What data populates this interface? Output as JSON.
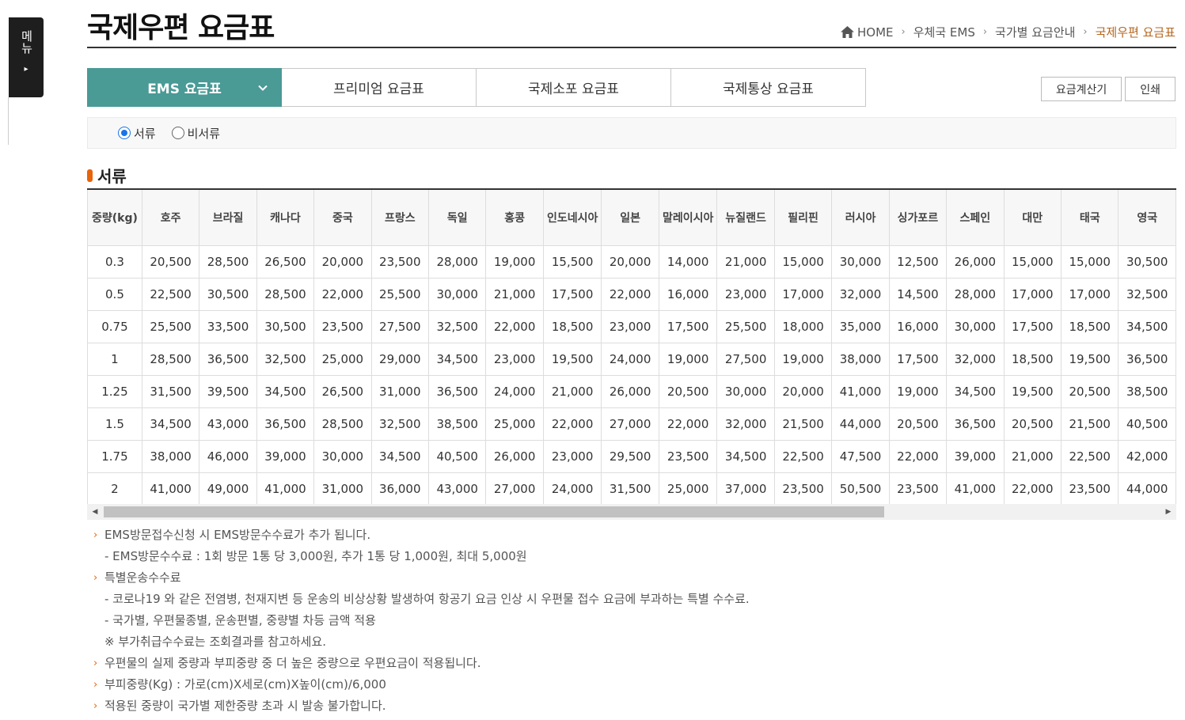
{
  "side_menu": {
    "label": "메뉴",
    "arrow": "▸"
  },
  "page_title": "국제우편 요금표",
  "breadcrumb": [
    "HOME",
    "우체국 EMS",
    "국가별 요금안내",
    "국제우편 요금표"
  ],
  "tabs": [
    "EMS 요금표",
    "프리미엄 요금표",
    "국제소포 요금표",
    "국제통상 요금표"
  ],
  "tools": {
    "calc": "요금계산기",
    "print": "인쇄"
  },
  "radios": {
    "doc": "서류",
    "nondoc": "비서류",
    "selected": "doc"
  },
  "section_title": "서류",
  "table": {
    "weight_header": "중량(kg)",
    "countries": [
      "호주",
      "브라질",
      "캐나다",
      "중국",
      "프랑스",
      "독일",
      "홍콩",
      "인도네시아",
      "일본",
      "말레이시아",
      "뉴질랜드",
      "필리핀",
      "러시아",
      "싱가포르",
      "스페인",
      "대만",
      "태국",
      "영국"
    ],
    "rows": [
      {
        "w": "0.3",
        "v": [
          "20,500",
          "28,500",
          "26,500",
          "20,000",
          "23,500",
          "28,000",
          "19,000",
          "15,500",
          "20,000",
          "14,000",
          "21,000",
          "15,000",
          "30,000",
          "12,500",
          "26,000",
          "15,000",
          "15,000",
          "30,500"
        ]
      },
      {
        "w": "0.5",
        "v": [
          "22,500",
          "30,500",
          "28,500",
          "22,000",
          "25,500",
          "30,000",
          "21,000",
          "17,500",
          "22,000",
          "16,000",
          "23,000",
          "17,000",
          "32,000",
          "14,500",
          "28,000",
          "17,000",
          "17,000",
          "32,500"
        ]
      },
      {
        "w": "0.75",
        "v": [
          "25,500",
          "33,500",
          "30,500",
          "23,500",
          "27,500",
          "32,500",
          "22,000",
          "18,500",
          "23,000",
          "17,500",
          "25,500",
          "18,000",
          "35,000",
          "16,000",
          "30,000",
          "17,500",
          "18,500",
          "34,500"
        ]
      },
      {
        "w": "1",
        "v": [
          "28,500",
          "36,500",
          "32,500",
          "25,000",
          "29,000",
          "34,500",
          "23,000",
          "19,500",
          "24,000",
          "19,000",
          "27,500",
          "19,000",
          "38,000",
          "17,500",
          "32,000",
          "18,500",
          "19,500",
          "36,500"
        ]
      },
      {
        "w": "1.25",
        "v": [
          "31,500",
          "39,500",
          "34,500",
          "26,500",
          "31,000",
          "36,500",
          "24,000",
          "21,000",
          "26,000",
          "20,500",
          "30,000",
          "20,000",
          "41,000",
          "19,000",
          "34,500",
          "19,500",
          "20,500",
          "38,500"
        ]
      },
      {
        "w": "1.5",
        "v": [
          "34,500",
          "43,000",
          "36,500",
          "28,500",
          "32,500",
          "38,500",
          "25,000",
          "22,000",
          "27,000",
          "22,000",
          "32,000",
          "21,500",
          "44,000",
          "20,500",
          "36,500",
          "20,500",
          "21,500",
          "40,500"
        ]
      },
      {
        "w": "1.75",
        "v": [
          "38,000",
          "46,000",
          "39,000",
          "30,000",
          "34,500",
          "40,500",
          "26,000",
          "23,000",
          "29,500",
          "23,500",
          "34,500",
          "22,500",
          "47,500",
          "22,000",
          "39,000",
          "21,000",
          "22,500",
          "42,000"
        ]
      },
      {
        "w": "2",
        "v": [
          "41,000",
          "49,000",
          "41,000",
          "31,000",
          "36,000",
          "43,000",
          "27,000",
          "24,000",
          "31,500",
          "25,000",
          "37,000",
          "23,500",
          "50,500",
          "23,500",
          "41,000",
          "22,000",
          "23,500",
          "44,000"
        ]
      }
    ]
  },
  "scroll": {
    "left": "◀",
    "right": "▶"
  },
  "notes": [
    {
      "type": "main",
      "text": "EMS방문접수신청 시 EMS방문수수료가 추가 됩니다."
    },
    {
      "type": "sub",
      "text": "- EMS방문수수료 : 1회 방문 1통 당 3,000원, 추가 1통 당 1,000원, 최대 5,000원"
    },
    {
      "type": "main",
      "text": "특별운송수수료"
    },
    {
      "type": "sub",
      "text": "- 코로나19 와 같은 전염병, 천재지변 등 운송의 비상상황 발생하여 항공기 요금 인상 시 우편물 접수 요금에 부과하는 특별 수수료."
    },
    {
      "type": "sub",
      "text": "- 국가별, 우편물종별, 운송편별, 중량별 차등 금액 적용"
    },
    {
      "type": "sub",
      "text": "※ 부가취급수수료는 조회결과를 참고하세요."
    },
    {
      "type": "main",
      "text": "우편물의 실제 중량과 부피중량 중 더 높은 중량으로 우편요금이 적용됩니다."
    },
    {
      "type": "main",
      "text": "부피중량(Kg) : 가로(cm)X세로(cm)X높이(cm)/6,000"
    },
    {
      "type": "main",
      "text": "적용된 중량이 국가별 제한중량 초과 시 발송 불가합니다."
    }
  ],
  "colors": {
    "accent": "#4a9a96",
    "bullet": "#e8630a",
    "breadcrumb_current": "#b5651d"
  },
  "icons": {
    "home": "home-icon",
    "chevron": "chevron-down-icon",
    "arrow": "arrow-right-icon"
  }
}
